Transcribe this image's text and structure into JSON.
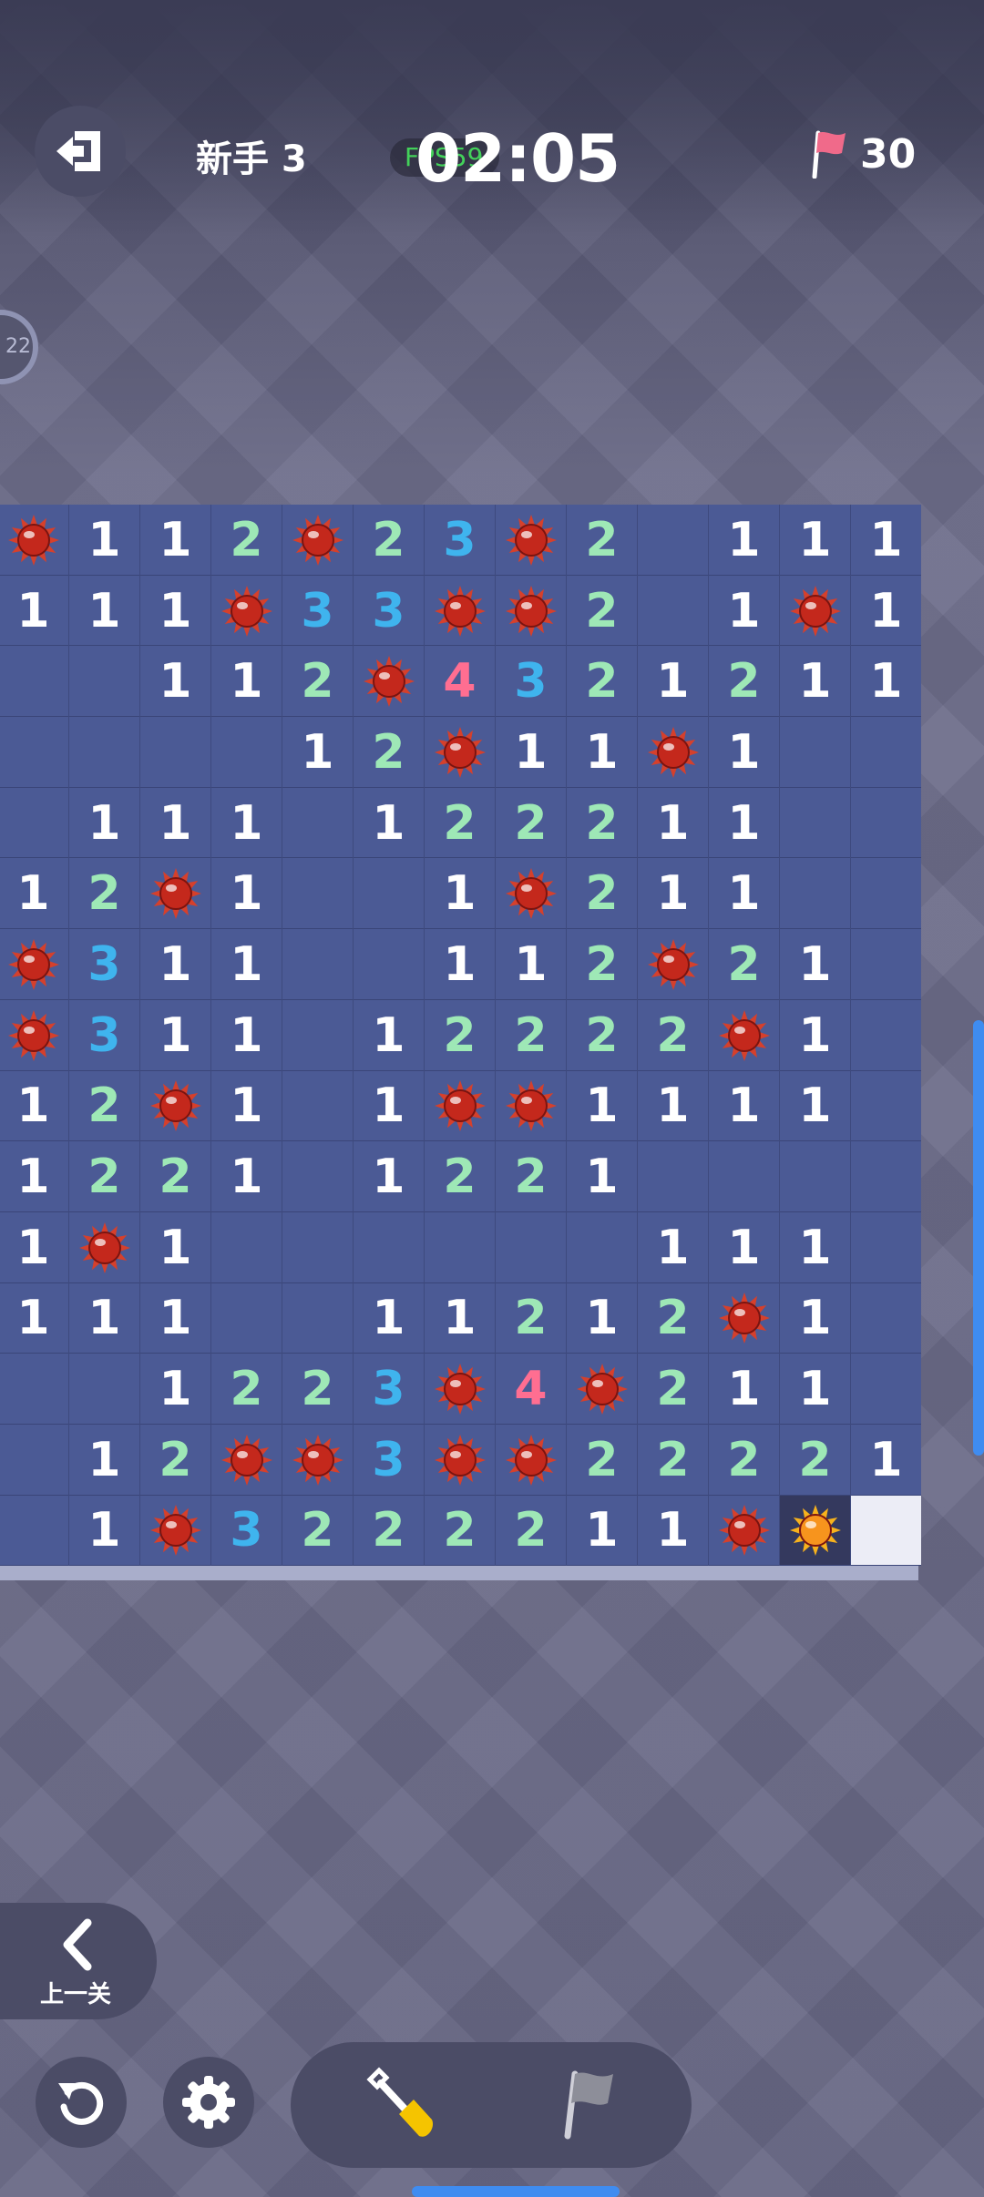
{
  "header": {
    "level_label": "新手 3",
    "fps_label": "FPS59",
    "timer": "02:05",
    "flags_left": "30"
  },
  "side_badge": {
    "label": "22"
  },
  "board": {
    "rows": [
      [
        "M",
        "1",
        "1",
        "2",
        "M",
        "2",
        "3",
        "M",
        "2",
        "",
        "1",
        "1",
        "1"
      ],
      [
        "1",
        "1",
        "1",
        "M",
        "3",
        "3",
        "M",
        "M",
        "2",
        "",
        "1",
        "M",
        "1"
      ],
      [
        "",
        "",
        "1",
        "1",
        "2",
        "M",
        "4",
        "3",
        "2",
        "1",
        "2",
        "1",
        "1"
      ],
      [
        "",
        "",
        "",
        "",
        "1",
        "2",
        "M",
        "1",
        "1",
        "M",
        "1",
        "",
        ""
      ],
      [
        "",
        "1",
        "1",
        "1",
        "",
        "1",
        "2",
        "2",
        "2",
        "1",
        "1",
        "",
        ""
      ],
      [
        "1",
        "2",
        "M",
        "1",
        "",
        "",
        "1",
        "M",
        "2",
        "1",
        "1",
        "",
        ""
      ],
      [
        "M",
        "3",
        "1",
        "1",
        "",
        "",
        "1",
        "1",
        "2",
        "M",
        "2",
        "1",
        ""
      ],
      [
        "M",
        "3",
        "1",
        "1",
        "",
        "1",
        "2",
        "2",
        "2",
        "2",
        "M",
        "1",
        ""
      ],
      [
        "1",
        "2",
        "M",
        "1",
        "",
        "1",
        "M",
        "M",
        "1",
        "1",
        "1",
        "1",
        ""
      ],
      [
        "1",
        "2",
        "2",
        "1",
        "",
        "1",
        "2",
        "2",
        "1",
        "",
        "",
        "",
        ""
      ],
      [
        "1",
        "M",
        "1",
        "",
        "",
        "",
        "",
        "",
        "",
        "1",
        "1",
        "1",
        ""
      ],
      [
        "1",
        "1",
        "1",
        "",
        "",
        "1",
        "1",
        "2",
        "1",
        "2",
        "M",
        "1",
        ""
      ],
      [
        "",
        "",
        "1",
        "2",
        "2",
        "3",
        "M",
        "4",
        "M",
        "2",
        "1",
        "1",
        ""
      ],
      [
        "",
        "1",
        "2",
        "M",
        "M",
        "3",
        "M",
        "M",
        "2",
        "2",
        "2",
        "2",
        "1"
      ],
      [
        "",
        "1",
        "M",
        "3",
        "2",
        "2",
        "2",
        "2",
        "1",
        "1",
        "M",
        "X",
        "W"
      ]
    ],
    "legend": {
      "M": "mine",
      "X": "exploded mine",
      "W": "unrevealed",
      "": "empty"
    }
  },
  "controls": {
    "prev_level_label": "上一关",
    "icons": {
      "exit": "exit-icon",
      "restart": "restart-icon",
      "settings": "gear-icon",
      "dig": "shovel-icon",
      "flag": "flag-icon"
    }
  },
  "colors": {
    "number_1": "#ffffff",
    "number_2": "#9ee8b6",
    "number_3": "#3fb4ee",
    "number_4": "#ff6e91",
    "mine": "#c4281c",
    "exploded_mine": "#f7941d",
    "cell": "#4b5a95",
    "accent": "#3f8cf0"
  }
}
